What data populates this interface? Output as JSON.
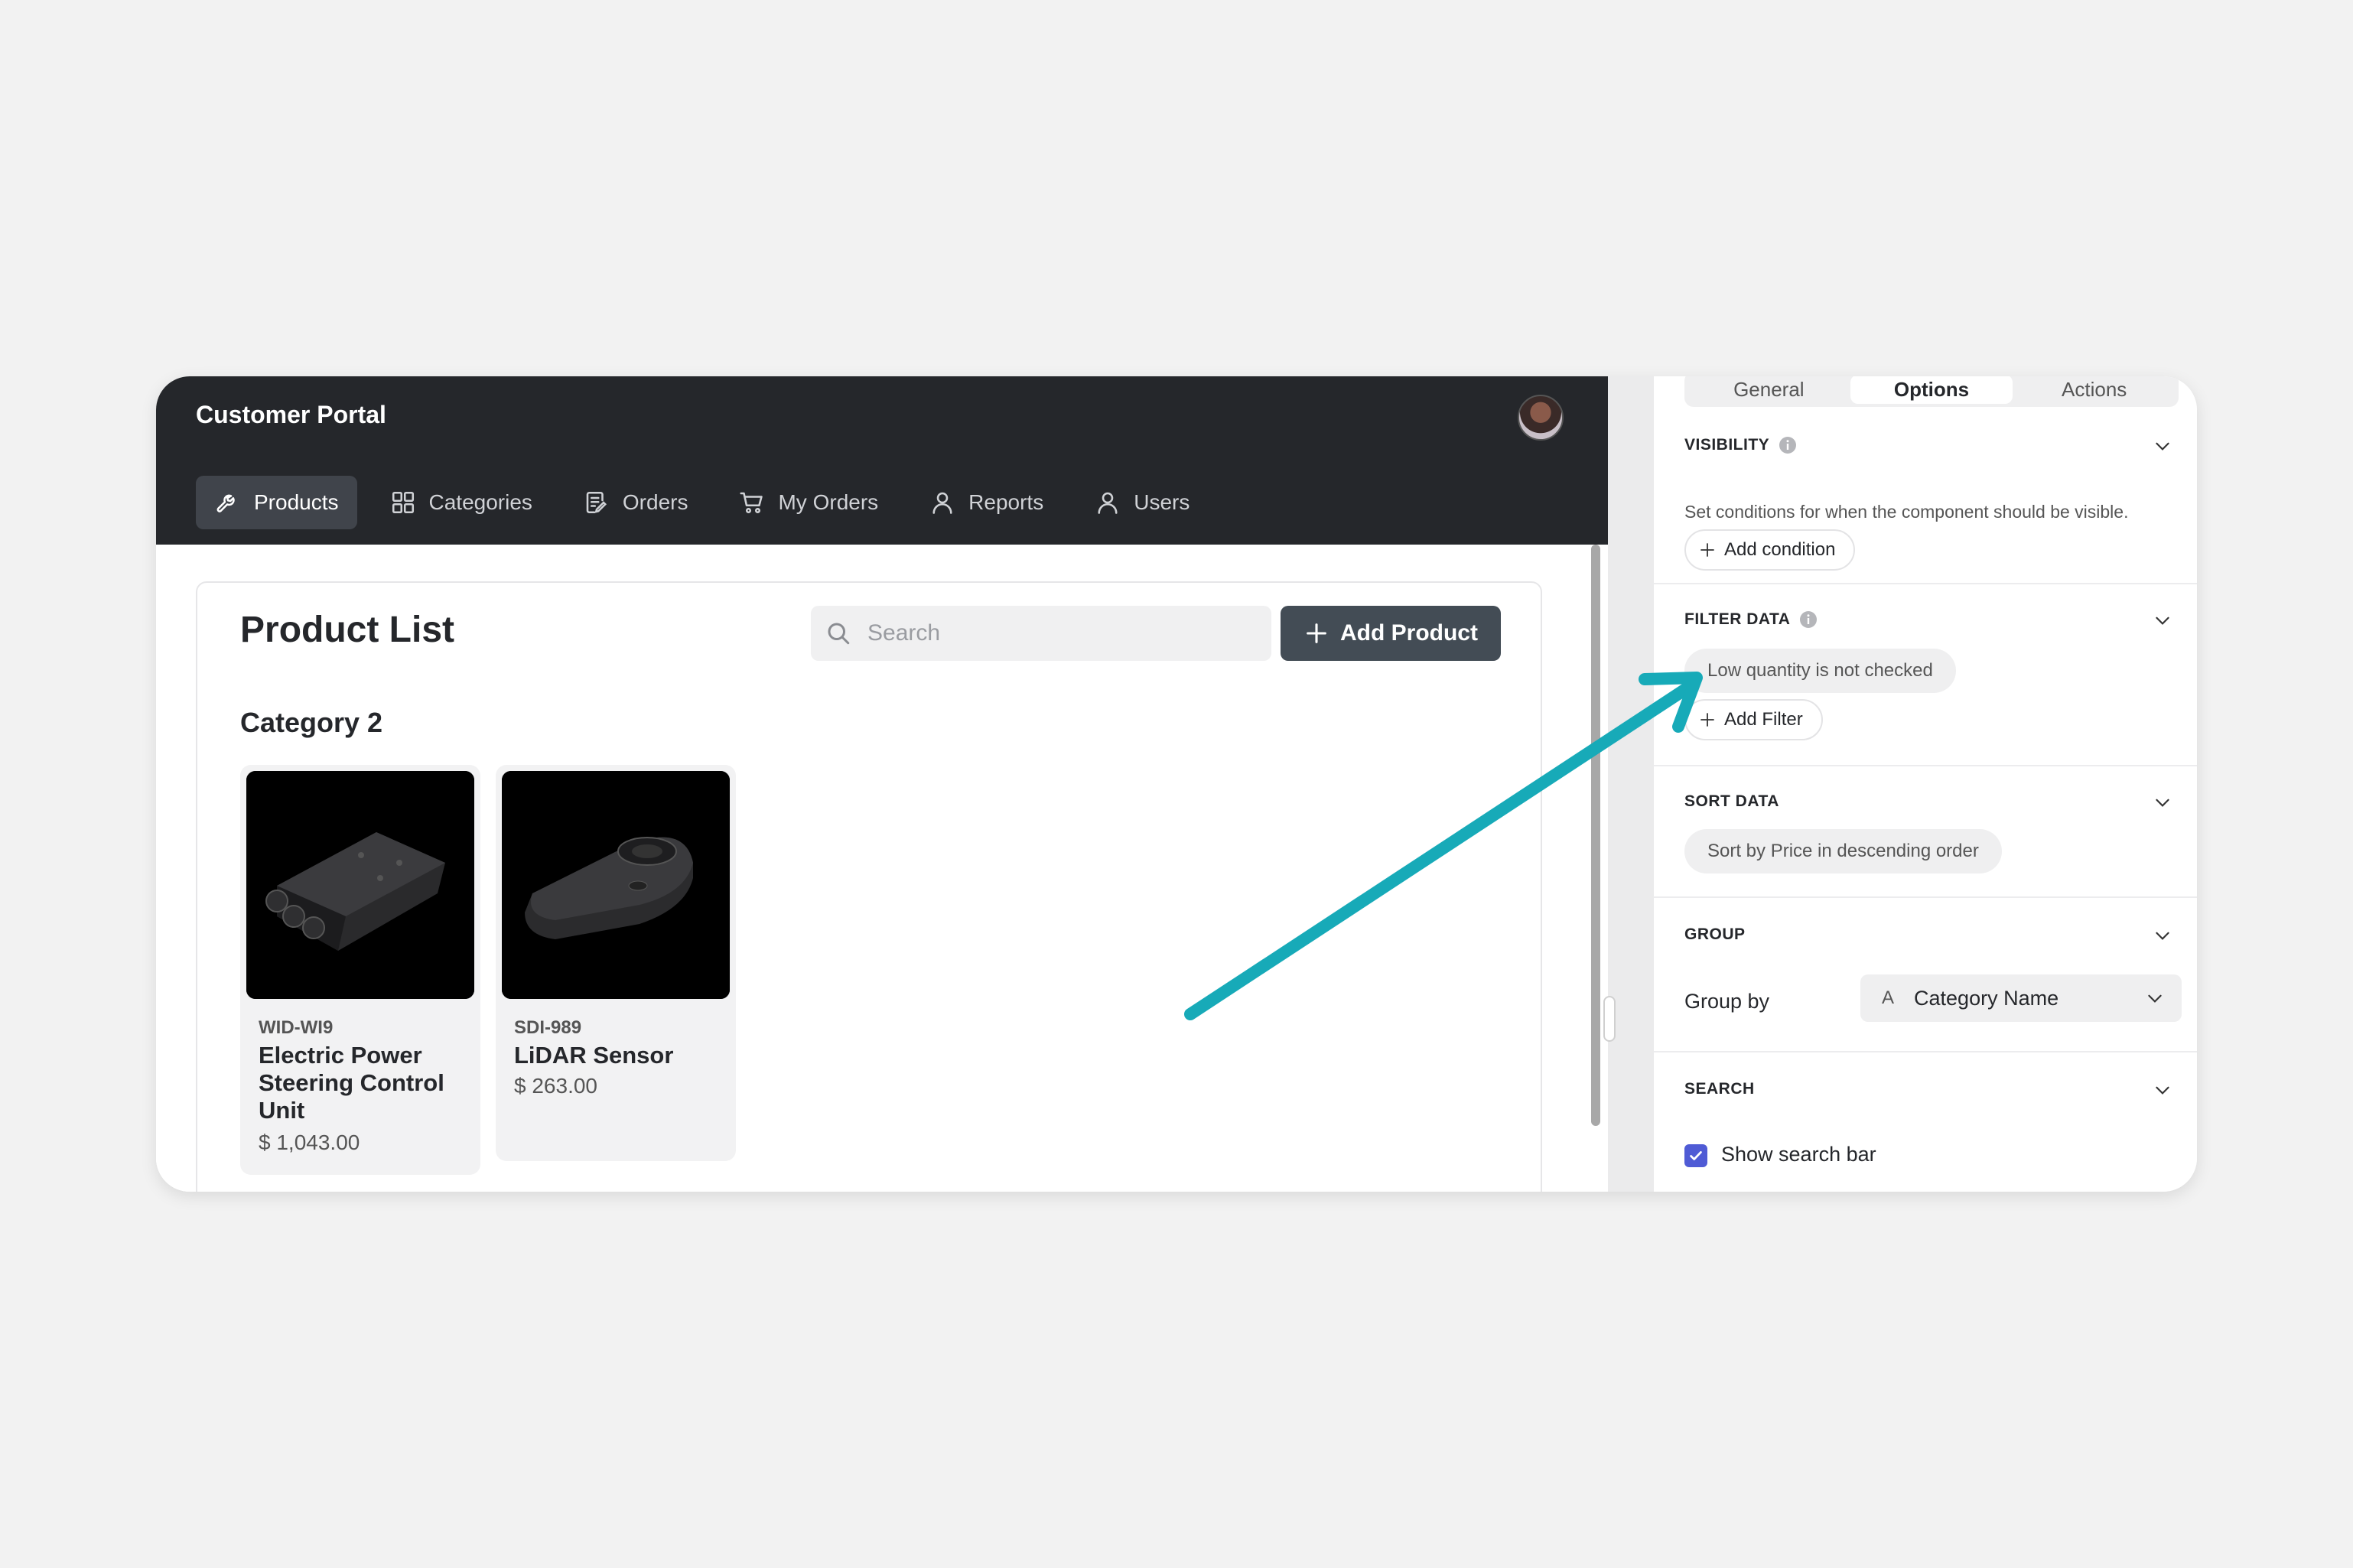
{
  "app": {
    "title": "Customer Portal",
    "nav": [
      {
        "label": "Products",
        "icon": "wrench-icon",
        "active": true
      },
      {
        "label": "Categories",
        "icon": "grid-icon",
        "active": false
      },
      {
        "label": "Orders",
        "icon": "document-edit-icon",
        "active": false
      },
      {
        "label": "My Orders",
        "icon": "cart-icon",
        "active": false
      },
      {
        "label": "Reports",
        "icon": "person-icon",
        "active": false
      },
      {
        "label": "Users",
        "icon": "person-icon",
        "active": false
      }
    ]
  },
  "main": {
    "title": "Product List",
    "search_placeholder": "Search",
    "add_label": "Add Product",
    "category": "Category 2",
    "products": [
      {
        "sku": "WID-WI9",
        "name": "Electric Power Steering Control Unit",
        "price": "$ 1,043.00"
      },
      {
        "sku": "SDI-989",
        "name": "LiDAR Sensor",
        "price": "$ 263.00"
      }
    ]
  },
  "panel": {
    "tabs": [
      {
        "label": "General",
        "active": false
      },
      {
        "label": "Options",
        "active": true
      },
      {
        "label": "Actions",
        "active": false
      }
    ],
    "visibility": {
      "heading": "VISIBILITY",
      "description": "Set conditions for when the component should be visible.",
      "add_label": "Add condition"
    },
    "filter": {
      "heading": "FILTER DATA",
      "chip": "Low quantity is not checked",
      "add_label": "Add Filter"
    },
    "sort": {
      "heading": "SORT DATA",
      "chip": "Sort by Price in descending order"
    },
    "group": {
      "heading": "GROUP",
      "label": "Group by",
      "type_glyph": "A",
      "value": "Category Name"
    },
    "search": {
      "heading": "SEARCH",
      "checkbox_label": "Show search bar",
      "checked": true
    }
  },
  "colors": {
    "topbar": "#25272b",
    "button": "#434c55",
    "checkbox": "#4f5bd5",
    "arrow": "#17aab8"
  }
}
